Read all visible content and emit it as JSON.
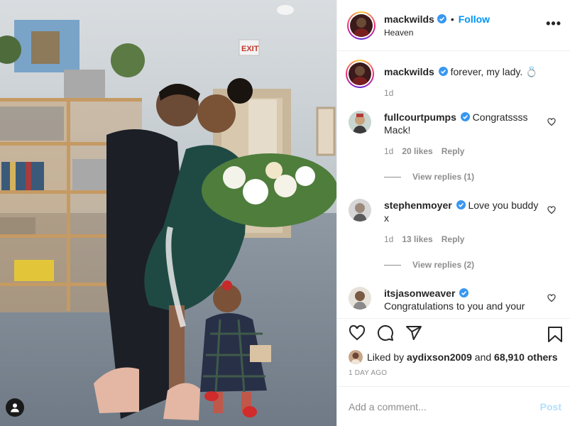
{
  "post": {
    "username": "mackwilds",
    "follow_label": "Follow",
    "separator": "•",
    "location": "Heaven",
    "more_label": "•••",
    "caption": "forever, my lady. 💍",
    "caption_age": "1d"
  },
  "comments": [
    {
      "username": "fullcourtpumps",
      "text": "Congratssss Mack!",
      "age": "1d",
      "likes": "20 likes",
      "reply": "Reply",
      "view_replies": "View replies (1)"
    },
    {
      "username": "stephenmoyer",
      "text": "Love you buddy x",
      "age": "1d",
      "likes": "13 likes",
      "reply": "Reply",
      "view_replies": "View replies (2)"
    },
    {
      "username": "itsjasonweaver",
      "text": "Congratulations to you and your"
    }
  ],
  "likes": {
    "prefix": "Liked by",
    "user": "aydixson2009",
    "middle": "and",
    "count": "68,910 others"
  },
  "timestamp": "1 DAY AGO",
  "composer": {
    "placeholder": "Add a comment...",
    "post_label": "Post"
  },
  "colors": {
    "link_blue": "#0095f6",
    "post_disabled": "#b2dffc",
    "verified_blue": "#3897f0",
    "muted": "#8e8e8e"
  },
  "icons": [
    "heart-icon",
    "comment-icon",
    "share-icon",
    "bookmark-icon",
    "verified-icon",
    "user-tag-icon",
    "more-icon"
  ]
}
